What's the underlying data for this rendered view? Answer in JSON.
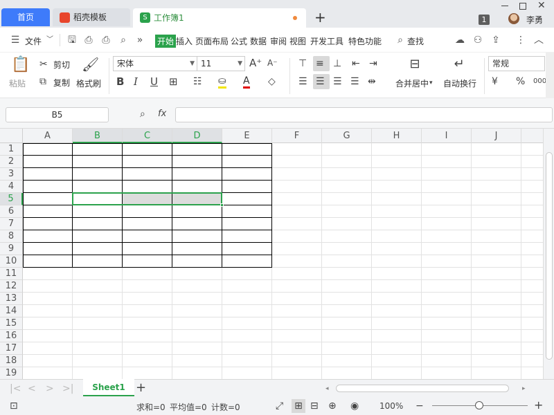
{
  "tabs": {
    "home": "首页",
    "template": "稻壳模板",
    "workbook": "工作簿1",
    "workbook_icon": "S",
    "new_tab": "+"
  },
  "user": {
    "badge": "1",
    "name": "李勇"
  },
  "menu": {
    "file": "文件",
    "items": [
      "开始",
      "插入",
      "页面布局",
      "公式",
      "数据",
      "审阅",
      "视图",
      "开发工具",
      "特色功能"
    ],
    "search": "查找"
  },
  "ribbon": {
    "paste": "粘贴",
    "cut": "剪切",
    "copy": "复制",
    "format_painter": "格式刷",
    "font_name": "宋体",
    "font_size": "11",
    "merge_center": "合并居中",
    "wrap_text": "自动换行",
    "number_format": "常规"
  },
  "formula_bar": {
    "name_box": "B5",
    "fx": "fx",
    "formula": ""
  },
  "sheet": {
    "columns": [
      "A",
      "B",
      "C",
      "D",
      "E",
      "F",
      "G",
      "H",
      "I",
      "J"
    ],
    "rows": [
      "1",
      "2",
      "3",
      "4",
      "5",
      "6",
      "7",
      "8",
      "9",
      "10",
      "11",
      "12",
      "13",
      "14",
      "15",
      "16",
      "17",
      "18",
      "19"
    ],
    "selected_cell": "B5",
    "selected_range": "B5:D5",
    "bordered_range": "A1:E10"
  },
  "sheet_tabs": {
    "active": "Sheet1",
    "add": "+"
  },
  "status": {
    "sum": "求和=0",
    "average": "平均值=0",
    "count": "计数=0",
    "zoom": "100%"
  },
  "colors": {
    "accent_green": "#2ba24c",
    "home_tab_blue": "#3e7bfa"
  }
}
